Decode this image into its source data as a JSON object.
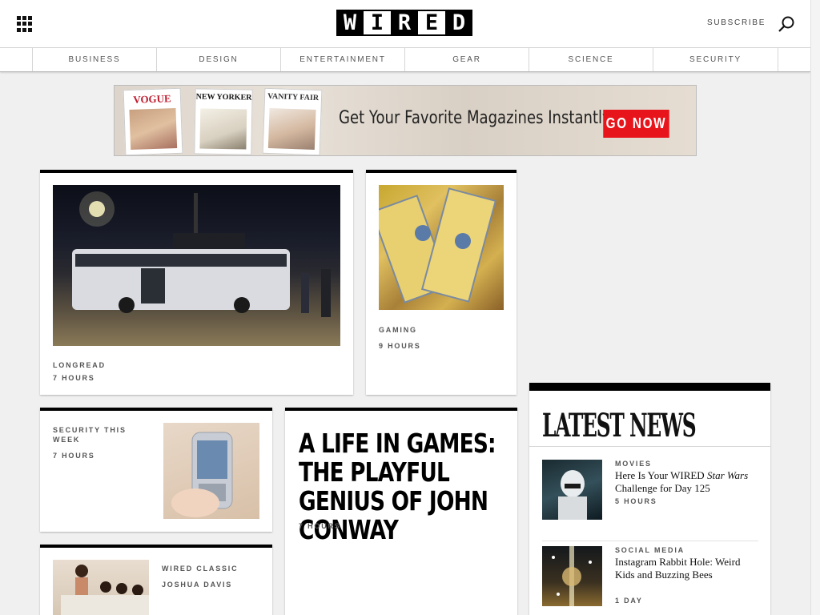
{
  "header": {
    "logo_letters": [
      "W",
      "I",
      "R",
      "E",
      "D"
    ],
    "subscribe_label": "SUBSCRIBE"
  },
  "nav": {
    "items": [
      {
        "label": "BUSINESS"
      },
      {
        "label": "DESIGN"
      },
      {
        "label": "ENTERTAINMENT"
      },
      {
        "label": "GEAR"
      },
      {
        "label": "SCIENCE"
      },
      {
        "label": "SECURITY"
      }
    ]
  },
  "ad": {
    "covers": [
      "VOGUE",
      "NEW YORKER",
      "VANITY FAIR"
    ],
    "tagline": "Get Your Favorite Magazines Instantly",
    "cta_label": "GO NOW"
  },
  "cards": {
    "longread": {
      "category": "LONGREAD",
      "time": "7 HOURS"
    },
    "gaming": {
      "category": "GAMING",
      "time": "9 HOURS"
    },
    "security": {
      "category": "SECURITY THIS WEEK",
      "time": "7 HOURS"
    },
    "feature": {
      "headline": "A LIFE IN GAMES: THE PLAYFUL GENIUS OF JOHN CONWAY",
      "time": "7 HOURS"
    },
    "classic": {
      "category": "WIRED CLASSIC",
      "author": "JOSHUA DAVIS"
    }
  },
  "latest_news": {
    "title": "LATEST NEWS",
    "items": [
      {
        "category": "MOVIES",
        "title_part1": "Here Is Your WIRED ",
        "title_em": "Star Wars",
        "title_part2": " Challenge for Day 125",
        "time": "5 HOURS"
      },
      {
        "category": "SOCIAL MEDIA",
        "title": "Instagram Rabbit Hole: Weird Kids and Buzzing Bees",
        "time": "1 DAY"
      }
    ]
  }
}
